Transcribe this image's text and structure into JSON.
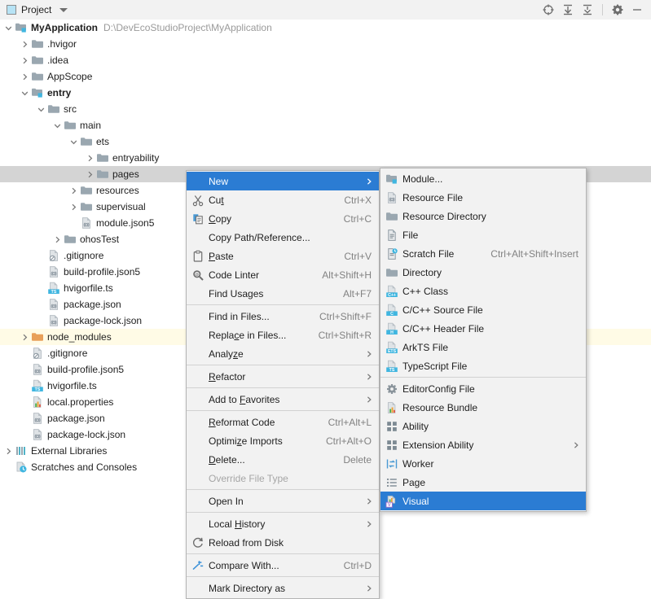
{
  "toolwindow": {
    "title": "Project",
    "icons": [
      {
        "name": "locate-icon",
        "label": "Select Opened File"
      },
      {
        "name": "expand-all-icon",
        "label": "Expand All"
      },
      {
        "name": "collapse-all-icon",
        "label": "Collapse All"
      },
      {
        "name": "gear-icon",
        "label": "Options"
      },
      {
        "name": "minimize-icon",
        "label": "Hide"
      }
    ]
  },
  "colors": {
    "selection_blue": "#2b7cd3",
    "row_selected_gray": "#d4d4d4",
    "row_highlight_yellow": "#fffbe6",
    "menu_bg": "#f2f2f2",
    "folder_gray": "#9aa7b0",
    "folder_orange": "#e8a05a",
    "accent_cyan": "#40b6e0",
    "text": "#1e1e1e",
    "muted_text": "#9a9a9a"
  },
  "tree": [
    {
      "label": "MyApplication",
      "path": "D:\\DevEcoStudioProject\\MyApplication",
      "depth": 0,
      "twisty": "down",
      "icon": "module-icon",
      "bold": true,
      "state": "normal"
    },
    {
      "label": ".hvigor",
      "depth": 1,
      "twisty": "right",
      "icon": "folder-icon",
      "state": "normal"
    },
    {
      "label": ".idea",
      "depth": 1,
      "twisty": "right",
      "icon": "folder-icon",
      "state": "normal"
    },
    {
      "label": "AppScope",
      "depth": 1,
      "twisty": "right",
      "icon": "folder-icon",
      "state": "normal"
    },
    {
      "label": "entry",
      "depth": 1,
      "twisty": "down",
      "icon": "module-icon",
      "bold": true,
      "state": "normal"
    },
    {
      "label": "src",
      "depth": 2,
      "twisty": "down",
      "icon": "folder-icon",
      "state": "normal"
    },
    {
      "label": "main",
      "depth": 3,
      "twisty": "down",
      "icon": "folder-icon",
      "state": "normal"
    },
    {
      "label": "ets",
      "depth": 4,
      "twisty": "down",
      "icon": "folder-icon",
      "state": "normal"
    },
    {
      "label": "entryability",
      "depth": 5,
      "twisty": "right",
      "icon": "folder-icon",
      "state": "normal"
    },
    {
      "label": "pages",
      "depth": 5,
      "twisty": "right",
      "icon": "folder-icon",
      "state": "selected"
    },
    {
      "label": "resources",
      "depth": 4,
      "twisty": "right",
      "icon": "folder-icon",
      "state": "normal"
    },
    {
      "label": "supervisual",
      "depth": 4,
      "twisty": "right",
      "icon": "folder-icon",
      "state": "normal"
    },
    {
      "label": "module.json5",
      "depth": 4,
      "twisty": "none",
      "icon": "json-file-icon",
      "state": "normal"
    },
    {
      "label": "ohosTest",
      "depth": 3,
      "twisty": "right",
      "icon": "folder-icon",
      "state": "normal"
    },
    {
      "label": ".gitignore",
      "depth": 2,
      "twisty": "none",
      "icon": "gitignore-file-icon",
      "state": "normal"
    },
    {
      "label": "build-profile.json5",
      "depth": 2,
      "twisty": "none",
      "icon": "json-file-icon",
      "state": "normal"
    },
    {
      "label": "hvigorfile.ts",
      "depth": 2,
      "twisty": "none",
      "icon": "ts-file-icon",
      "state": "normal"
    },
    {
      "label": "package.json",
      "depth": 2,
      "twisty": "none",
      "icon": "json-file-icon",
      "state": "normal"
    },
    {
      "label": "package-lock.json",
      "depth": 2,
      "twisty": "none",
      "icon": "json-file-icon",
      "state": "normal"
    },
    {
      "label": "node_modules",
      "depth": 1,
      "twisty": "right",
      "icon": "folder-orange-icon",
      "state": "highlight"
    },
    {
      "label": ".gitignore",
      "depth": 1,
      "twisty": "none",
      "icon": "gitignore-file-icon",
      "state": "normal"
    },
    {
      "label": "build-profile.json5",
      "depth": 1,
      "twisty": "none",
      "icon": "json-file-icon",
      "state": "normal"
    },
    {
      "label": "hvigorfile.ts",
      "depth": 1,
      "twisty": "none",
      "icon": "ts-file-icon",
      "state": "normal"
    },
    {
      "label": "local.properties",
      "depth": 1,
      "twisty": "none",
      "icon": "properties-file-icon",
      "state": "normal"
    },
    {
      "label": "package.json",
      "depth": 1,
      "twisty": "none",
      "icon": "json-file-icon",
      "state": "normal"
    },
    {
      "label": "package-lock.json",
      "depth": 1,
      "twisty": "none",
      "icon": "json-file-icon",
      "state": "normal"
    },
    {
      "label": "External Libraries",
      "depth": 0,
      "twisty": "right",
      "icon": "libraries-icon",
      "state": "normal"
    },
    {
      "label": "Scratches and Consoles",
      "depth": 0,
      "twisty": "none",
      "icon": "scratches-icon",
      "state": "normal"
    }
  ],
  "context_menu": [
    {
      "label": "New",
      "icon": "none",
      "accel": "",
      "arrow": true,
      "state": "selected"
    },
    {
      "label": "Cut",
      "mnemonic": "t",
      "icon": "cut-icon",
      "accel": "Ctrl+X"
    },
    {
      "label": "Copy",
      "mnemonic": "C",
      "icon": "copy-icon",
      "accel": "Ctrl+C"
    },
    {
      "label": "Copy Path/Reference...",
      "icon": "none",
      "accel": ""
    },
    {
      "label": "Paste",
      "mnemonic": "P",
      "icon": "paste-icon",
      "accel": "Ctrl+V"
    },
    {
      "label": "Code Linter",
      "icon": "code-linter-icon",
      "accel": "Alt+Shift+H"
    },
    {
      "label": "Find Usages",
      "icon": "none",
      "accel": "Alt+F7"
    },
    {
      "separator": true
    },
    {
      "label": "Find in Files...",
      "icon": "none",
      "accel": "Ctrl+Shift+F"
    },
    {
      "label": "Replace in Files...",
      "mnemonic": "c",
      "icon": "none",
      "accel": "Ctrl+Shift+R"
    },
    {
      "label": "Analyze",
      "mnemonic": "z",
      "icon": "none",
      "accel": "",
      "arrow": true
    },
    {
      "separator": true
    },
    {
      "label": "Refactor",
      "mnemonic": "R",
      "icon": "none",
      "accel": "",
      "arrow": true
    },
    {
      "separator": true
    },
    {
      "label": "Add to Favorites",
      "mnemonic": "F",
      "icon": "none",
      "accel": "",
      "arrow": true
    },
    {
      "separator": true
    },
    {
      "label": "Reformat Code",
      "mnemonic": "R",
      "icon": "none",
      "accel": "Ctrl+Alt+L"
    },
    {
      "label": "Optimize Imports",
      "mnemonic": "z",
      "icon": "none",
      "accel": "Ctrl+Alt+O"
    },
    {
      "label": "Delete...",
      "mnemonic": "D",
      "icon": "none",
      "accel": "Delete"
    },
    {
      "label": "Override File Type",
      "icon": "none",
      "accel": "",
      "disabled": true
    },
    {
      "separator": true
    },
    {
      "label": "Open In",
      "icon": "none",
      "accel": "",
      "arrow": true
    },
    {
      "separator": true
    },
    {
      "label": "Local History",
      "mnemonic": "H",
      "icon": "none",
      "accel": "",
      "arrow": true
    },
    {
      "label": "Reload from Disk",
      "icon": "reload-icon",
      "accel": ""
    },
    {
      "separator": true
    },
    {
      "label": "Compare With...",
      "icon": "compare-icon",
      "accel": "Ctrl+D"
    },
    {
      "separator": true
    },
    {
      "label": "Mark Directory as",
      "icon": "none",
      "accel": "",
      "arrow": true
    }
  ],
  "new_submenu": [
    {
      "label": "Module...",
      "icon": "module-icon",
      "accel": ""
    },
    {
      "label": "Resource File",
      "icon": "json-file-icon",
      "accel": ""
    },
    {
      "label": "Resource Directory",
      "icon": "folder-icon",
      "accel": ""
    },
    {
      "label": "File",
      "icon": "plain-file-icon",
      "accel": ""
    },
    {
      "label": "Scratch File",
      "icon": "scratch-file-icon",
      "accel": "Ctrl+Alt+Shift+Insert"
    },
    {
      "label": "Directory",
      "icon": "folder-icon",
      "accel": ""
    },
    {
      "label": "C++ Class",
      "icon": "cpp-class-icon",
      "accel": ""
    },
    {
      "label": "C/C++ Source File",
      "icon": "c-source-icon",
      "accel": ""
    },
    {
      "label": "C/C++ Header File",
      "icon": "h-header-icon",
      "accel": ""
    },
    {
      "label": "ArkTS File",
      "icon": "ets-file-icon",
      "accel": ""
    },
    {
      "label": "TypeScript File",
      "icon": "ts-file-icon",
      "accel": ""
    },
    {
      "separator": true
    },
    {
      "label": "EditorConfig File",
      "icon": "gear-icon",
      "accel": ""
    },
    {
      "label": "Resource Bundle",
      "icon": "properties-file-icon",
      "accel": ""
    },
    {
      "label": "Ability",
      "icon": "ability-icon",
      "accel": ""
    },
    {
      "label": "Extension Ability",
      "icon": "ability-icon",
      "accel": "",
      "arrow": true
    },
    {
      "label": "Worker",
      "icon": "worker-icon",
      "accel": ""
    },
    {
      "label": "Page",
      "icon": "page-icon",
      "accel": ""
    },
    {
      "label": "Visual",
      "icon": "visual-icon",
      "accel": "",
      "state": "selected"
    }
  ]
}
